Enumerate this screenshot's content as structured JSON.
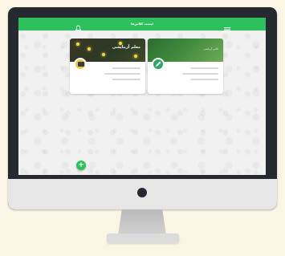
{
  "appbar": {
    "title": "لیست کلاس‌ها",
    "color": "#2fc05e"
  },
  "icons": {
    "menu": "hamburger-menu-icon",
    "notifications": "bell-icon",
    "add": "plus-icon"
  },
  "cards": [
    {
      "title": "معلم آزمایشی",
      "subtitle": "",
      "avatar_color": "#f0c83c"
    },
    {
      "title": "کلاس آزمایشی",
      "subtitle": "",
      "avatar_color": "#2fa569"
    }
  ],
  "fab": {
    "label": "+"
  }
}
